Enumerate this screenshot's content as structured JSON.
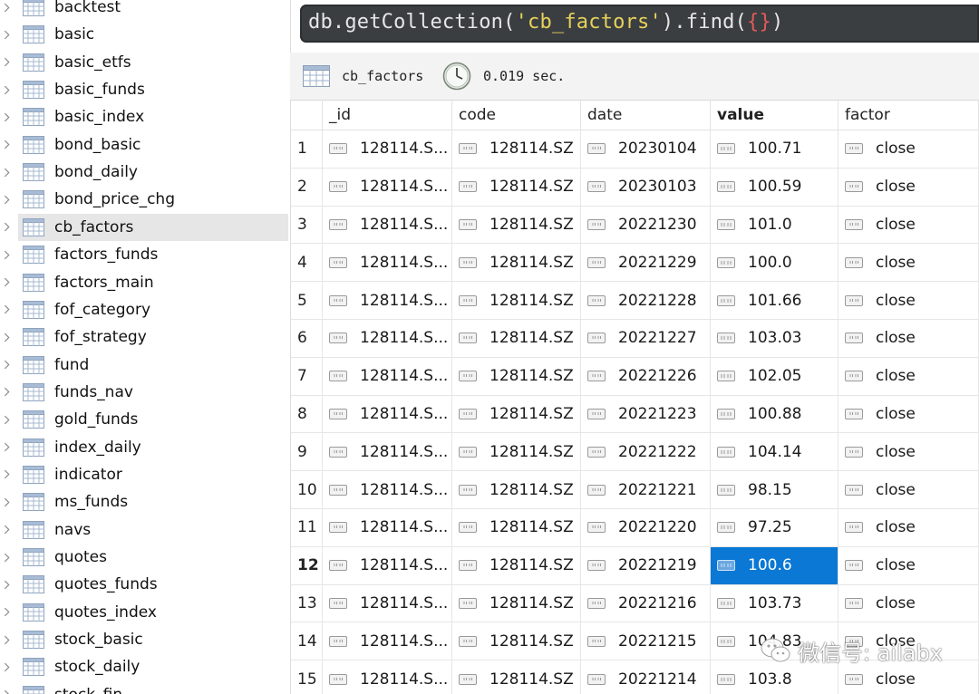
{
  "sidebar": {
    "items": [
      {
        "label": "backtest"
      },
      {
        "label": "basic"
      },
      {
        "label": "basic_etfs"
      },
      {
        "label": "basic_funds"
      },
      {
        "label": "basic_index"
      },
      {
        "label": "bond_basic"
      },
      {
        "label": "bond_daily"
      },
      {
        "label": "bond_price_chg"
      },
      {
        "label": "cb_factors",
        "active": true
      },
      {
        "label": "factors_funds"
      },
      {
        "label": "factors_main"
      },
      {
        "label": "fof_category"
      },
      {
        "label": "fof_strategy"
      },
      {
        "label": "fund"
      },
      {
        "label": "funds_nav"
      },
      {
        "label": "gold_funds"
      },
      {
        "label": "index_daily"
      },
      {
        "label": "indicator"
      },
      {
        "label": "ms_funds"
      },
      {
        "label": "navs"
      },
      {
        "label": "quotes"
      },
      {
        "label": "quotes_funds"
      },
      {
        "label": "quotes_index"
      },
      {
        "label": "stock_basic"
      },
      {
        "label": "stock_daily"
      },
      {
        "label": "stock_fin"
      }
    ]
  },
  "query": {
    "prefix": "db.getCollection(",
    "collection_literal": "'cb_factors'",
    "middle": ").find(",
    "open_brace": "{",
    "close_brace": "}",
    "suffix": ")"
  },
  "result_header": {
    "collection": "cb_factors",
    "elapsed": "0.019 sec."
  },
  "grid": {
    "columns": [
      "_id",
      "code",
      "date",
      "value",
      "factor"
    ],
    "sorted_column": "value",
    "rows": [
      {
        "n": "1",
        "id": "128114.S...",
        "code": "128114.SZ",
        "date": "20230104",
        "value": "100.71",
        "factor": "close"
      },
      {
        "n": "2",
        "id": "128114.S...",
        "code": "128114.SZ",
        "date": "20230103",
        "value": "100.59",
        "factor": "close"
      },
      {
        "n": "3",
        "id": "128114.S...",
        "code": "128114.SZ",
        "date": "20221230",
        "value": "101.0",
        "factor": "close"
      },
      {
        "n": "4",
        "id": "128114.S...",
        "code": "128114.SZ",
        "date": "20221229",
        "value": "100.0",
        "factor": "close"
      },
      {
        "n": "5",
        "id": "128114.S...",
        "code": "128114.SZ",
        "date": "20221228",
        "value": "101.66",
        "factor": "close"
      },
      {
        "n": "6",
        "id": "128114.S...",
        "code": "128114.SZ",
        "date": "20221227",
        "value": "103.03",
        "factor": "close"
      },
      {
        "n": "7",
        "id": "128114.S...",
        "code": "128114.SZ",
        "date": "20221226",
        "value": "102.05",
        "factor": "close"
      },
      {
        "n": "8",
        "id": "128114.S...",
        "code": "128114.SZ",
        "date": "20221223",
        "value": "100.88",
        "factor": "close"
      },
      {
        "n": "9",
        "id": "128114.S...",
        "code": "128114.SZ",
        "date": "20221222",
        "value": "104.14",
        "factor": "close"
      },
      {
        "n": "10",
        "id": "128114.S...",
        "code": "128114.SZ",
        "date": "20221221",
        "value": "98.15",
        "factor": "close"
      },
      {
        "n": "11",
        "id": "128114.S...",
        "code": "128114.SZ",
        "date": "20221220",
        "value": "97.25",
        "factor": "close"
      },
      {
        "n": "12",
        "id": "128114.S...",
        "code": "128114.SZ",
        "date": "20221219",
        "value": "100.6",
        "factor": "close",
        "selected": true
      },
      {
        "n": "13",
        "id": "128114.S...",
        "code": "128114.SZ",
        "date": "20221216",
        "value": "103.73",
        "factor": "close"
      },
      {
        "n": "14",
        "id": "128114.S...",
        "code": "128114.SZ",
        "date": "20221215",
        "value": "104.83",
        "factor": "close"
      },
      {
        "n": "15",
        "id": "128114.S...",
        "code": "128114.SZ",
        "date": "20221214",
        "value": "103.8",
        "factor": "close"
      }
    ]
  },
  "watermark": {
    "text": "微信号: ailabx"
  },
  "colors": {
    "selection": "#0a78d4",
    "query_bg": "#3b3e41",
    "string_literal": "#e6d25a",
    "brace": "#e05a5a"
  },
  "icons": {
    "sidebar_item": "collection-table-icon",
    "expand": "chevron-right-icon",
    "result_header": [
      "table-icon",
      "clock-icon"
    ],
    "cell_types": [
      "object-id-icon",
      "string-icon",
      "string-icon",
      "number-icon",
      "string-icon"
    ]
  }
}
